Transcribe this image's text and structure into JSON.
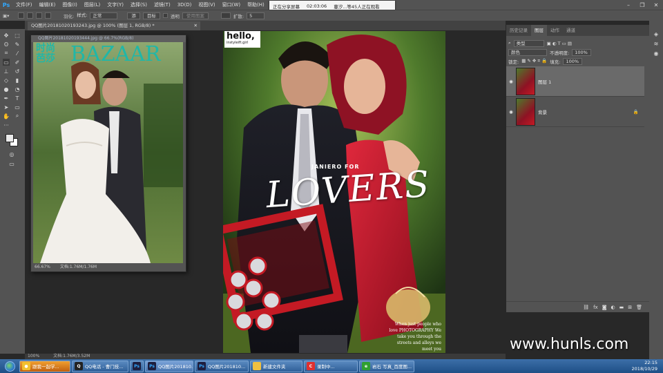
{
  "app": {
    "logo": "Ps"
  },
  "menubar": {
    "items": [
      "文件(F)",
      "编辑(E)",
      "图像(I)",
      "图层(L)",
      "文字(Y)",
      "选择(S)",
      "滤镜(T)",
      "3D(D)",
      "视图(V)",
      "窗口(W)",
      "帮助(H)"
    ]
  },
  "share_banner": {
    "status": "正在分享屏幕",
    "time": "02:03:06",
    "viewers": "蔓汐...等45人正在观看"
  },
  "options": {
    "feather_label": "羽化:",
    "style_label": "样式:",
    "style_value": "正常",
    "btn1": "添",
    "btn2": "目标",
    "transparent": "透明",
    "use_pattern": "使用图案",
    "spread_label": "扩散:",
    "spread_value": "5"
  },
  "document": {
    "tab_title": "QQ图片20181020193243.jpg @ 100% (图层 1, RGB/8) *",
    "zoom": "100%",
    "doc_info": "文档:1.76M/3.52M"
  },
  "float_doc": {
    "title": "QQ图片20181020193444.jpg @ 66.7%(RGB/8)",
    "zoom": "66.67%",
    "doc_info": "文档:1.76M/1.76M",
    "logo_cn": "时尚芭莎",
    "logo_en": "BAZAAR"
  },
  "artwork": {
    "hello": "hello,",
    "site": "instyleift.girl",
    "subtitle": "JANIERO FOR",
    "headline": "LOVERS",
    "caption": "When just people who love PHOTOGRAPHY We take you through the streets and alleys we meet you"
  },
  "panel": {
    "tabs": [
      "历史记录",
      "图层",
      "动作",
      "通道"
    ],
    "filter_label": "类型",
    "blend_mode": "颜色",
    "opacity_label": "不透明度:",
    "opacity_value": "100%",
    "lock_label": "锁定:",
    "fill_label": "填充:",
    "fill_value": "100%",
    "layers": [
      {
        "name": "图层 1"
      },
      {
        "name": "背景"
      }
    ]
  },
  "watermark": "www.hunls.com",
  "taskbar": {
    "tasks": [
      {
        "label": "跟我一起学...",
        "icon_color": "#e8a020"
      },
      {
        "label": "QQ电话 - 曹门技...",
        "icon_color": "#ffffff"
      },
      {
        "label": "",
        "icon_color": "#1e1e3e"
      },
      {
        "label": "QQ图片201810...",
        "icon_color": "#1e1e3e"
      },
      {
        "label": "QQ图片201810...",
        "icon_color": "#1e1e3e"
      },
      {
        "label": "新建文件夹",
        "icon_color": "#f0c040"
      },
      {
        "label": "录制中...",
        "icon_color": "#e03030"
      },
      {
        "label": "岩石 写真_百度图...",
        "icon_color": "#30a030"
      }
    ],
    "time": "22:15",
    "date": "2018/10/29"
  },
  "colors": {
    "ui_dark": "#535353",
    "canvas_bg": "#282828",
    "accent": "#31a8ff",
    "red_dress": "#c0142a"
  }
}
